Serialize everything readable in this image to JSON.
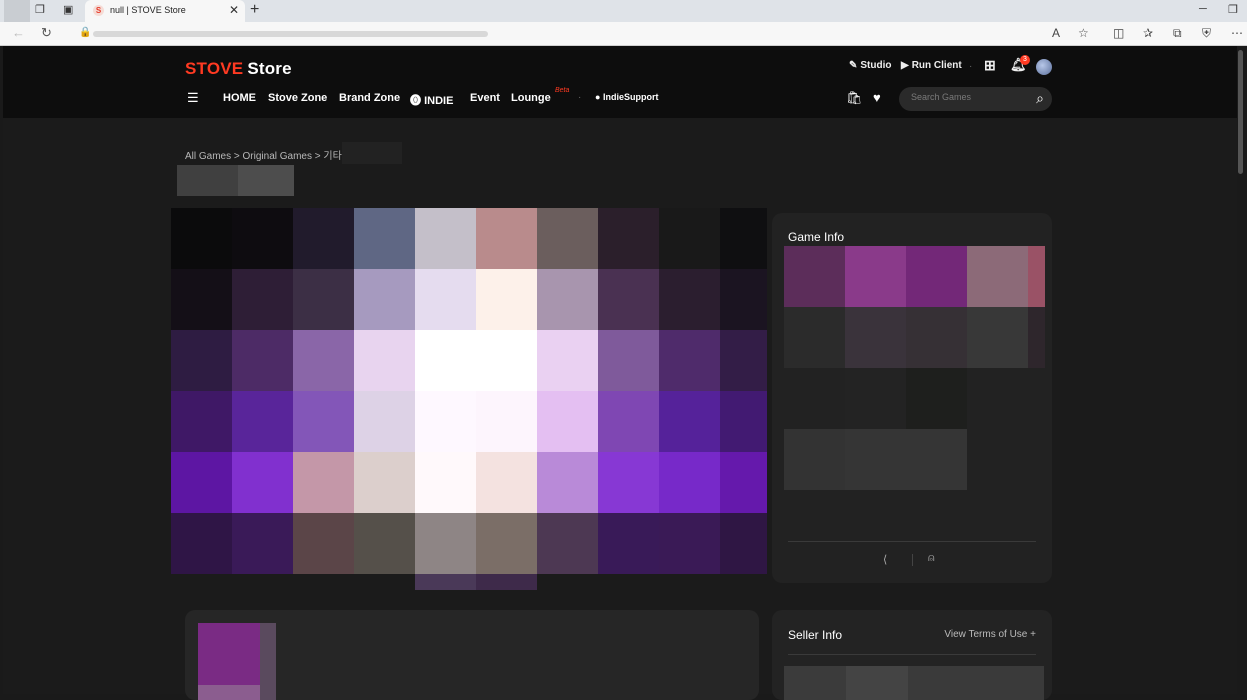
{
  "browser": {
    "tab_title": "null | STOVE Store",
    "tab_favicon": "S",
    "close_glyph": "✕",
    "new_tab_glyph": "+",
    "minimize_glyph": "─",
    "restore_glyph": "❐"
  },
  "header": {
    "logo_primary": "STOVE",
    "logo_secondary": "Store",
    "studio": "Studio",
    "run_client": "Run Client",
    "notification_count": "3",
    "nav": [
      {
        "label": "HOME"
      },
      {
        "label": "Stove Zone"
      },
      {
        "label": "Brand Zone"
      },
      {
        "label": "INDIE"
      },
      {
        "label": "Event"
      },
      {
        "label": "Lounge"
      }
    ],
    "lounge_badge": "Beta",
    "indie_support": "IndieSupport",
    "search_placeholder": "Search Games"
  },
  "breadcrumb": "All Games > Original Games > 기타 >",
  "game_info": {
    "title": "Game Info"
  },
  "seller_info": {
    "title": "Seller Info",
    "terms_link": "View Terms of Use"
  },
  "colors": {
    "brand_red": "#ff3a22",
    "header_bg": "#0d0d0d",
    "page_bg": "#1b1b1b",
    "card_bg": "#222222"
  }
}
